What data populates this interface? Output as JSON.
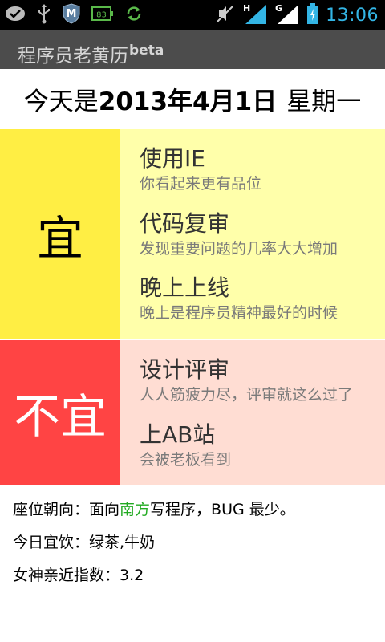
{
  "status_bar": {
    "left_icons": [
      "checkmark-icon",
      "usb-icon",
      "m-shield-icon",
      "battery-83-icon",
      "sync-icon"
    ],
    "battery_text": "83",
    "network_label_1": "H",
    "network_label_2": "G",
    "time": "13:06",
    "accent_color": "#33b5e5"
  },
  "app": {
    "title": "程序员老黄历",
    "title_suffix": "beta"
  },
  "date": {
    "prefix": "今天是",
    "value": "2013年4月1日",
    "weekday": "星期一"
  },
  "good": {
    "label": "宜",
    "color": "#ffee44",
    "items": [
      {
        "name": "使用IE",
        "desc": "你看起来更有品位"
      },
      {
        "name": "代码复审",
        "desc": "发现重要问题的几率大大增加"
      },
      {
        "name": "晚上上线",
        "desc": "晚上是程序员精神最好的时候"
      }
    ]
  },
  "bad": {
    "label": "不宜",
    "color": "#ff4444",
    "items": [
      {
        "name": "设计评审",
        "desc": "人人筋疲力尽，评审就这么过了"
      },
      {
        "name": "上AB站",
        "desc": "会被老板看到"
      }
    ]
  },
  "info": {
    "seat_prefix": "座位朝向：面向",
    "seat_direction": "南方",
    "seat_suffix": "写程序，BUG 最少。",
    "drink": "今日宜饮：绿茶,牛奶",
    "goddess": "女神亲近指数：3.2"
  }
}
